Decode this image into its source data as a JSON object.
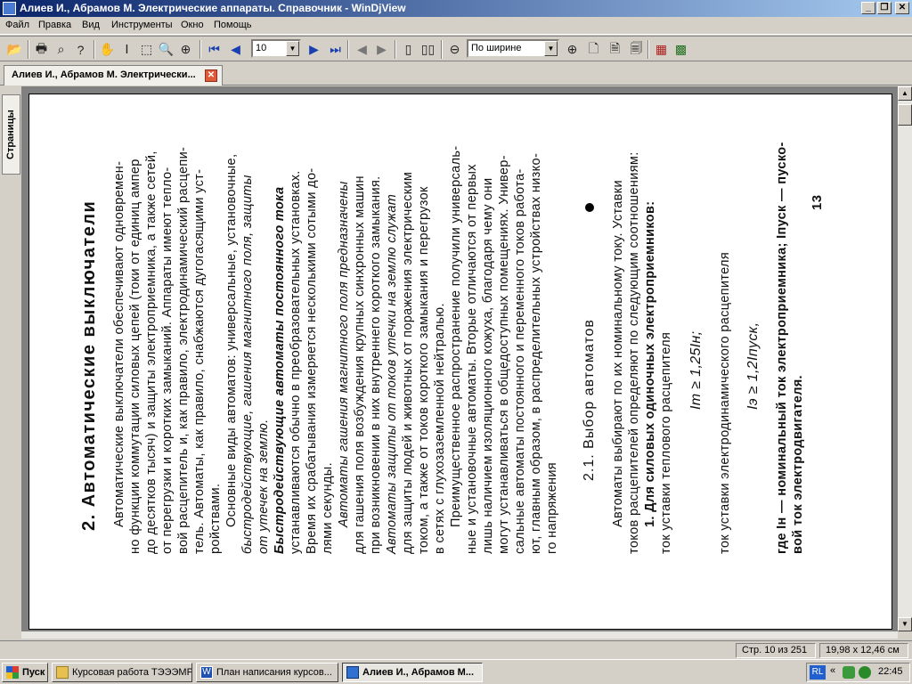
{
  "window": {
    "title": "Алиев И., Абрамов М. Электрические аппараты. Справочник - WinDjView"
  },
  "menu": [
    "Файл",
    "Правка",
    "Вид",
    "Инструменты",
    "Окно",
    "Помощь"
  ],
  "toolbar": {
    "page_number": "10",
    "zoom": "По ширине"
  },
  "tab": {
    "label": "Алиев И., Абрамов М. Электрически..."
  },
  "sidebar": {
    "pages_tab": "Страницы"
  },
  "document": {
    "lines": [
      "2.  Автоматические  выключатели",
      "Автоматические выключатели обеспечивают одновремен-",
      "но функции коммутации силовых цепей (токи от единиц ампер",
      "до десятков тысяч) и защиты электроприемника, а также сетей,",
      "от перегрузки и коротких замыканий. Аппараты имеют тепло-",
      "вой расцепитель и, как правило, электродинамический расцепи-",
      "тель. Автоматы, как правило, снабжаются дугогасящими уст-",
      "ройствами.",
      "Основные виды автоматов: универсальные, установочные,",
      "быстродействующие, гашения магнитного поля, защиты",
      "от утечек на землю.",
      "Быстродействующие автоматы постоянного тока",
      "устанавливаются обычно в преобразовательных установках.",
      "Время их срабатывания измеряется несколькими сотыми до-",
      "лями секунды.",
      "Автоматы гашения магнитного поля предназначены",
      "для гашения поля возбуждения крупных синхронных машин",
      "при возникновении в них внутреннего короткого замыкания.",
      "Автоматы защиты от токов утечки на землю служат",
      "для защиты людей и животных от поражения электрическим",
      "током, а также от токов короткого замыкания и перегрузок",
      "в сетях с глухозаземленной нейтралью.",
      "Преимущественное распространение получили универсаль-",
      "ные и установочные автоматы. Вторые отличаются от первых",
      "лишь наличием изоляционного кожуха, благодаря чему они",
      "могут устанавливаться в общедоступных помещениях. Универ-",
      "сальные автоматы постоянного и переменного токов работа-",
      "ют, главным образом, в распределительных устройствах низко-",
      "го напряжения",
      "2.1.  Выбор  автоматов",
      "Автоматы выбирают по их номинальному току. Уставки",
      "токов расцепителей определяют по следующим соотношениям:",
      "1. Для силовых одиночных электроприемников:",
      "ток уставки теплового расцепителя",
      "Iт ≥ 1,25Iн;",
      "ток уставки электродинамического расцепителя",
      "Iэ ≥ 1,2Iпуск,",
      "где Iн — номинальный ток электроприемника; Iпуск — пуско-",
      "вой ток электродвигателя.",
      "13"
    ]
  },
  "status": {
    "page": "Стр. 10 из 251",
    "size": "19,98 x 12,46 см"
  },
  "taskbar": {
    "start": "Пуск",
    "tasks": [
      "Курсовая работа ТЭЭЭМР",
      "План написания курсов...",
      "Алиев И., Абрамов М..."
    ],
    "lang": "RL",
    "clock": "22:45"
  }
}
